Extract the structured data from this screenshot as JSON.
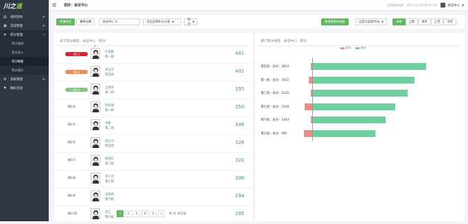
{
  "sidebar": {
    "logo": {
      "main": "川之",
      "accent": "道"
    },
    "items": [
      {
        "label": "组织架构",
        "icon": "org-icon"
      },
      {
        "label": "日常管理",
        "icon": "calendar-icon"
      },
      {
        "label": "积分管理",
        "icon": "star-icon"
      }
    ],
    "subitems": [
      "积分规则",
      "积分录入",
      "积分数据",
      "积分操作"
    ],
    "bottom": [
      {
        "label": "系统管理",
        "icon": "gear-icon"
      },
      {
        "label": "精彩活动",
        "icon": "flag-icon"
      }
    ]
  },
  "header": {
    "greeting": "您好：会议中心",
    "last_login": "上次登录时间：2017-12-29 16:07:04",
    "user": "会议中心"
  },
  "filters": {
    "tab_staff": "普通排名",
    "tab_score": "赛季分数",
    "meeting_value": "会议中心  X",
    "category_value": "点击选择积分分类",
    "score_value": "积分",
    "export": "管理者绩效面板",
    "date_value": "自定义起始时间",
    "ranges": [
      "本周",
      "上周",
      "本月",
      "上月",
      "今年"
    ]
  },
  "left_panel": {
    "title": "员工积分排名 - 会议中心 - 积分",
    "rows": [
      {
        "rank": "NO.1",
        "name": "叶德鹏",
        "group": "第一组",
        "score": "461"
      },
      {
        "rank": "NO.2",
        "name": "林玉玲",
        "group": "第五组",
        "score": "401"
      },
      {
        "rank": "NO.3",
        "name": "王晓英",
        "group": "第一组",
        "score": "355"
      },
      {
        "rank": "NO.4",
        "name": "何家骏",
        "group": "第一组",
        "score": "350"
      },
      {
        "rank": "NO.5",
        "name": "涂鹏",
        "group": "第二组",
        "score": "348"
      },
      {
        "rank": "NO.6",
        "name": "田立兴",
        "group": "第五组",
        "score": "328"
      },
      {
        "rank": "NO.7",
        "name": "陈晓钦",
        "group": "第二组",
        "score": "320"
      },
      {
        "rank": "NO.8",
        "name": "李小杰",
        "group": "第七组",
        "score": "306"
      },
      {
        "rank": "NO.9",
        "name": "吴晓莉",
        "group": "第六组",
        "score": "294"
      },
      {
        "rank": "NO.10",
        "name": "周江",
        "group": "第六组",
        "score": "285"
      }
    ],
    "badge_colors": [
      "#d9232d",
      "#ef8c5b",
      "#7fc97f"
    ],
    "pager": {
      "pages": [
        "1",
        "2",
        "3",
        "4",
        "5",
        "»"
      ],
      "total": "共 41 条记录"
    }
  },
  "right_panel": {
    "title": "部门积分排名 - 会议中心 - 积分",
    "legend": [
      {
        "label": "扣分",
        "color": "#ef8c84"
      },
      {
        "label": "加分",
        "color": "#6fd0a0"
      }
    ]
  },
  "chart_data": {
    "type": "bar",
    "orientation": "horizontal",
    "categories": [
      "第五组 - 总分：1814",
      "第一组 - 总分：1632",
      "第二组 - 总分：1520",
      "第七组 - 总分：1318",
      "第六组 - 总分：1163",
      "第三组 - 总分：995"
    ],
    "series": [
      {
        "name": "扣分",
        "values": [
          -10,
          -60,
          -20,
          -120,
          -10,
          -130
        ],
        "color": "#ef8c84"
      },
      {
        "name": "加分",
        "values": [
          1814,
          1632,
          1520,
          1318,
          1163,
          995
        ],
        "color": "#6fd0a0"
      }
    ],
    "xlim": [
      -160,
      1900
    ],
    "legend_position": "top-center",
    "grid": false
  }
}
